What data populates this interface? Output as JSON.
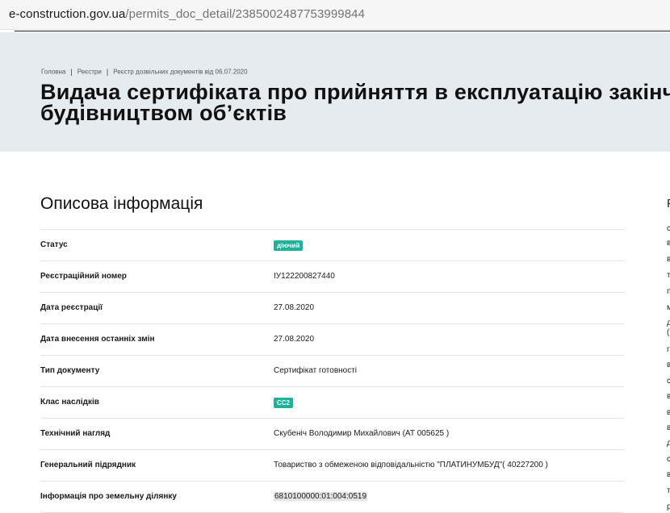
{
  "browser": {
    "url_host": "e-construction.gov.ua",
    "url_path": "/permits_doc_detail/2385002487753999844"
  },
  "breadcrumbs": [
    "Головна",
    "Реєстри",
    "Реєстр дозвільних документів від 06.07.2020"
  ],
  "page": {
    "title_line1": "Видача сертифіката про прийняття в експлуатацію закінчених",
    "title_line2": "будівництвом об’єктів"
  },
  "section": {
    "title": "Описова інформація"
  },
  "rows": [
    {
      "label": "Статус",
      "value": "діючий",
      "badge": true
    },
    {
      "label": "Реєстраційний номер",
      "value": "ІУ122200827440"
    },
    {
      "label": "Дата реєстрації",
      "value": "27.08.2020"
    },
    {
      "label": "Дата внесення останніх змін",
      "value": "27.08.2020"
    },
    {
      "label": "Тип документу",
      "value": "Сертифікат готовності"
    },
    {
      "label": "Клас наслідків",
      "value": "СС2",
      "badge": true
    },
    {
      "label": "Технічний нагляд",
      "value": "Скубеніч Володимир Михайлович (АТ 005625 )"
    },
    {
      "label": "Генеральний підрядник",
      "value": "Товариство з обмеженою відповідальністю \"ПЛАТИНУМБУД\"( 40227200 )"
    },
    {
      "label": "Інформація про земельну ділянку",
      "value": "6810100000:01:004:0519",
      "highlight": true
    }
  ],
  "sidebar_fragment": {
    "heading": "Р",
    "letters": [
      "с",
      "в",
      "в",
      "т",
      "п",
      "м",
      "д",
      "(",
      "г",
      "в",
      "с",
      "в",
      "в",
      "в",
      "д",
      "с",
      "в",
      "т",
      "р"
    ]
  },
  "colors": {
    "hero_bg": "#e6ebf0",
    "badge_green": "#1fb29a"
  }
}
